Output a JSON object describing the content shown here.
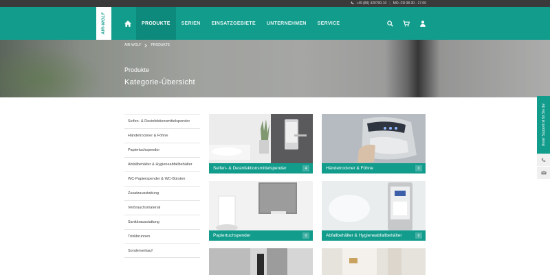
{
  "topbar": {
    "phone": "+49 (89) 420790-10",
    "hours": "MO–FR 08.30 - 17.00"
  },
  "brand": {
    "logo_text": "AIR-WOLF"
  },
  "nav": {
    "home_icon": "home-icon",
    "items": [
      {
        "label": "PRODUKTE",
        "active": true
      },
      {
        "label": "SERIEN"
      },
      {
        "label": "EINSATZGEBIETE"
      },
      {
        "label": "UNTERNEHMEN"
      },
      {
        "label": "SERVICE"
      }
    ]
  },
  "header_icons": [
    "search-icon",
    "cart-icon",
    "user-icon"
  ],
  "breadcrumb": {
    "root": "AIR-WOLF",
    "current": "PRODUKTE"
  },
  "hero": {
    "subtitle": "Produkte",
    "title": "Kategorie-Übersicht"
  },
  "sidebar": {
    "items": [
      "Seifen- & Desinfektionsmittelspender",
      "Händetrockner & Föhne",
      "Papiertuchspender",
      "Abfallbehälter & Hygieneabfallbehälter",
      "WC-Papierspender & WC-Bürsten",
      "Zusatzausstattung",
      "Verbrauchsmaterial",
      "Sanitärausstattung",
      "Trinkbrunnen",
      "Sonderverkauf"
    ]
  },
  "tiles": [
    {
      "label": "Seifen- & Desinfektionsmittelspender",
      "count": "4"
    },
    {
      "label": "Händetrockner & Föhne",
      "count": "0"
    },
    {
      "label": "Papiertuchspender",
      "count": "0"
    },
    {
      "label": "Abfallbehälter & Hygieneabfallbehälter",
      "count": "0"
    },
    {
      "label": "",
      "count": ""
    },
    {
      "label": "",
      "count": ""
    }
  ],
  "support": {
    "label": "Unser Support ist für Sie da!"
  },
  "colors": {
    "accent": "#129c8c",
    "accent_dark": "#0e8a7c",
    "topbar": "#3a3a3a"
  }
}
